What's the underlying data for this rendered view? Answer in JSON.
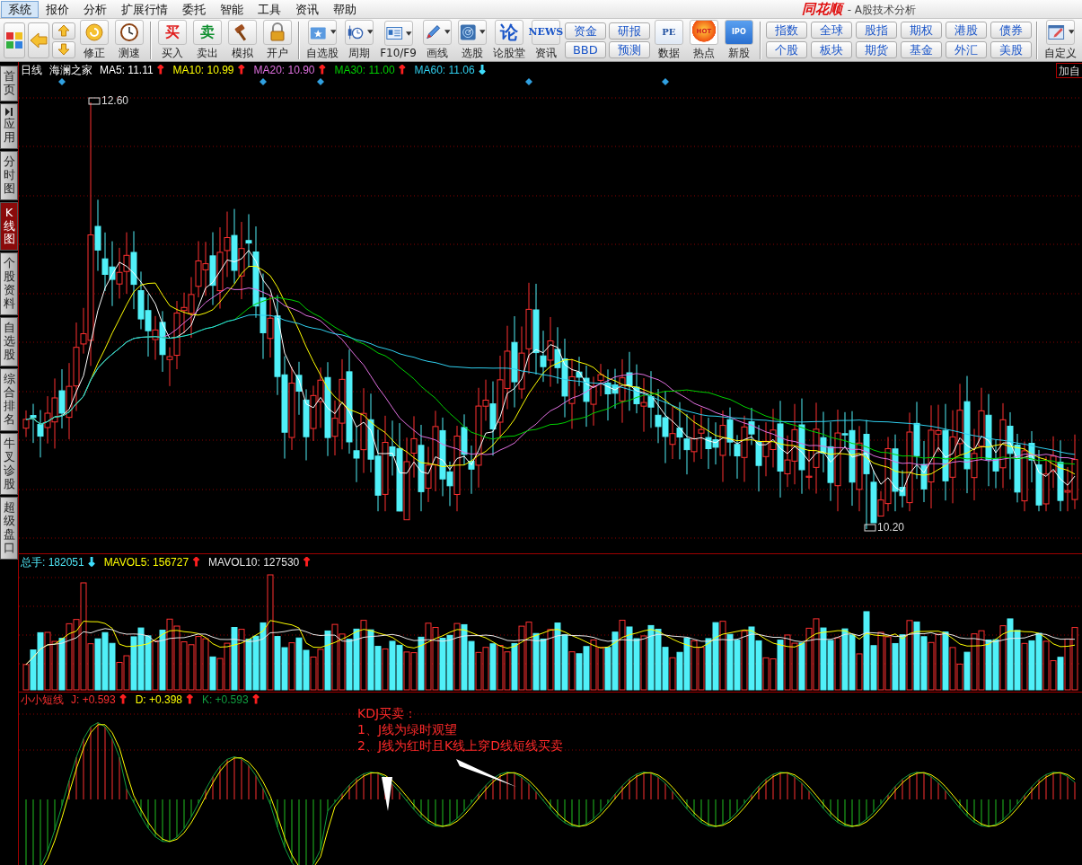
{
  "menu": [
    {
      "label": "系统",
      "selected": true
    },
    {
      "label": "报价",
      "selected": false
    },
    {
      "label": "分析",
      "selected": false
    },
    {
      "label": "扩展行情",
      "selected": false
    },
    {
      "label": "委托",
      "selected": false
    },
    {
      "label": "智能",
      "selected": false
    },
    {
      "label": "工具",
      "selected": false
    },
    {
      "label": "资讯",
      "selected": false
    },
    {
      "label": "帮助",
      "selected": false
    }
  ],
  "app_title": {
    "brand": "同花顺",
    "subtitle": "- A股技术分析"
  },
  "toolbar": [
    {
      "kind": "tile"
    },
    {
      "kind": "tile"
    },
    {
      "kind": "stack"
    },
    {
      "kind": "tool",
      "label": "修正"
    },
    {
      "kind": "tool",
      "label": "测速"
    },
    {
      "kind": "sep"
    },
    {
      "kind": "tool",
      "label": "买入",
      "glyph": "买"
    },
    {
      "kind": "tool",
      "label": "卖出",
      "glyph": "卖"
    },
    {
      "kind": "tool",
      "label": "模拟"
    },
    {
      "kind": "tool",
      "label": "开户"
    },
    {
      "kind": "sep"
    },
    {
      "kind": "dropdown",
      "label": "自选股"
    },
    {
      "kind": "dropdown",
      "label": "周期"
    },
    {
      "kind": "dropdown",
      "label": "F10/F9"
    },
    {
      "kind": "dropdown",
      "label": "画线"
    },
    {
      "kind": "dropdown",
      "label": "选股"
    },
    {
      "kind": "tool",
      "label": "论股堂",
      "glyph": "论"
    },
    {
      "kind": "tool",
      "label": "资讯",
      "glyph": "NEWS"
    },
    {
      "kind": "pair",
      "buttons": [
        "资金",
        "BBD"
      ]
    },
    {
      "kind": "pair",
      "buttons": [
        "研报",
        "预测"
      ]
    },
    {
      "kind": "tool",
      "label": "数据",
      "glyph": "PE"
    },
    {
      "kind": "tool",
      "label": "热点",
      "glyph": "HOT"
    },
    {
      "kind": "tool",
      "label": "新股",
      "glyph": "IPO"
    },
    {
      "kind": "sep"
    },
    {
      "kind": "grid",
      "buttons": [
        "指数",
        "全球",
        "股指",
        "期权",
        "港股",
        "债券",
        "个股",
        "板块",
        "期货",
        "基金",
        "外汇",
        "美股"
      ]
    },
    {
      "kind": "sep"
    },
    {
      "kind": "dropdown",
      "label": "自定义"
    }
  ],
  "sidebar": [
    {
      "label": "首页",
      "selected": false
    },
    {
      "label": "应用",
      "selected": false
    },
    {
      "label": "分时图",
      "selected": false
    },
    {
      "label": "K线图",
      "selected": true
    },
    {
      "label": "个股资料",
      "selected": false
    },
    {
      "label": "自选股",
      "selected": false
    },
    {
      "label": "综合排名",
      "selected": false
    },
    {
      "label": "牛叉诊股",
      "selected": false
    },
    {
      "label": "超级盘口",
      "selected": false
    }
  ],
  "price_pane": {
    "period": "日线",
    "stock": "海澜之家",
    "corner_button": "加自",
    "items": [
      {
        "label": "MA5: 11.11",
        "color": "#ffffff",
        "arrow": {
          "text": "↑",
          "color": "#ff2020"
        }
      },
      {
        "label": "MA10: 10.99",
        "color": "#ffff00",
        "arrow": {
          "text": "↑",
          "color": "#ff2020"
        }
      },
      {
        "label": "MA20: 10.90",
        "color": "#e070e0",
        "arrow": {
          "text": "↑",
          "color": "#ff2020"
        }
      },
      {
        "label": "MA30: 11.00",
        "color": "#00d000",
        "arrow": {
          "text": "↑",
          "color": "#ff2020"
        }
      },
      {
        "label": "MA60: 11.06",
        "color": "#30d0f0",
        "arrow": {
          "text": "↓",
          "color": "#40e0ff"
        }
      }
    ],
    "high_label": "12.60",
    "low_label": "10.20"
  },
  "volume_pane": {
    "items": [
      {
        "label": "总手: 182051",
        "color": "#50e8f8",
        "arrow": {
          "text": "↓",
          "color": "#40e0ff"
        }
      },
      {
        "label": "MAVOL5: 156727",
        "color": "#ffff00",
        "arrow": {
          "text": "↑",
          "color": "#ff2020"
        }
      },
      {
        "label": "MAVOL10: 127530",
        "color": "#e8e8e8",
        "arrow": {
          "text": "↑",
          "color": "#ff2020"
        }
      }
    ]
  },
  "kdj_pane": {
    "name": "小小短线",
    "items": [
      {
        "label": "J: +0.593",
        "color": "#ff3030",
        "arrow": {
          "text": "↑",
          "color": "#ff2020"
        }
      },
      {
        "label": "D: +0.398",
        "color": "#ffff00",
        "arrow": {
          "text": "↑",
          "color": "#ff2020"
        }
      },
      {
        "label": "K: +0.593",
        "color": "#10a040",
        "arrow": {
          "text": "↑",
          "color": "#ff2020"
        }
      }
    ],
    "note": {
      "title": "KDJ买卖：",
      "lines": [
        "1、J线为绿时观望",
        "2、J线为红时且K线上穿D线短线买卖"
      ]
    }
  }
}
